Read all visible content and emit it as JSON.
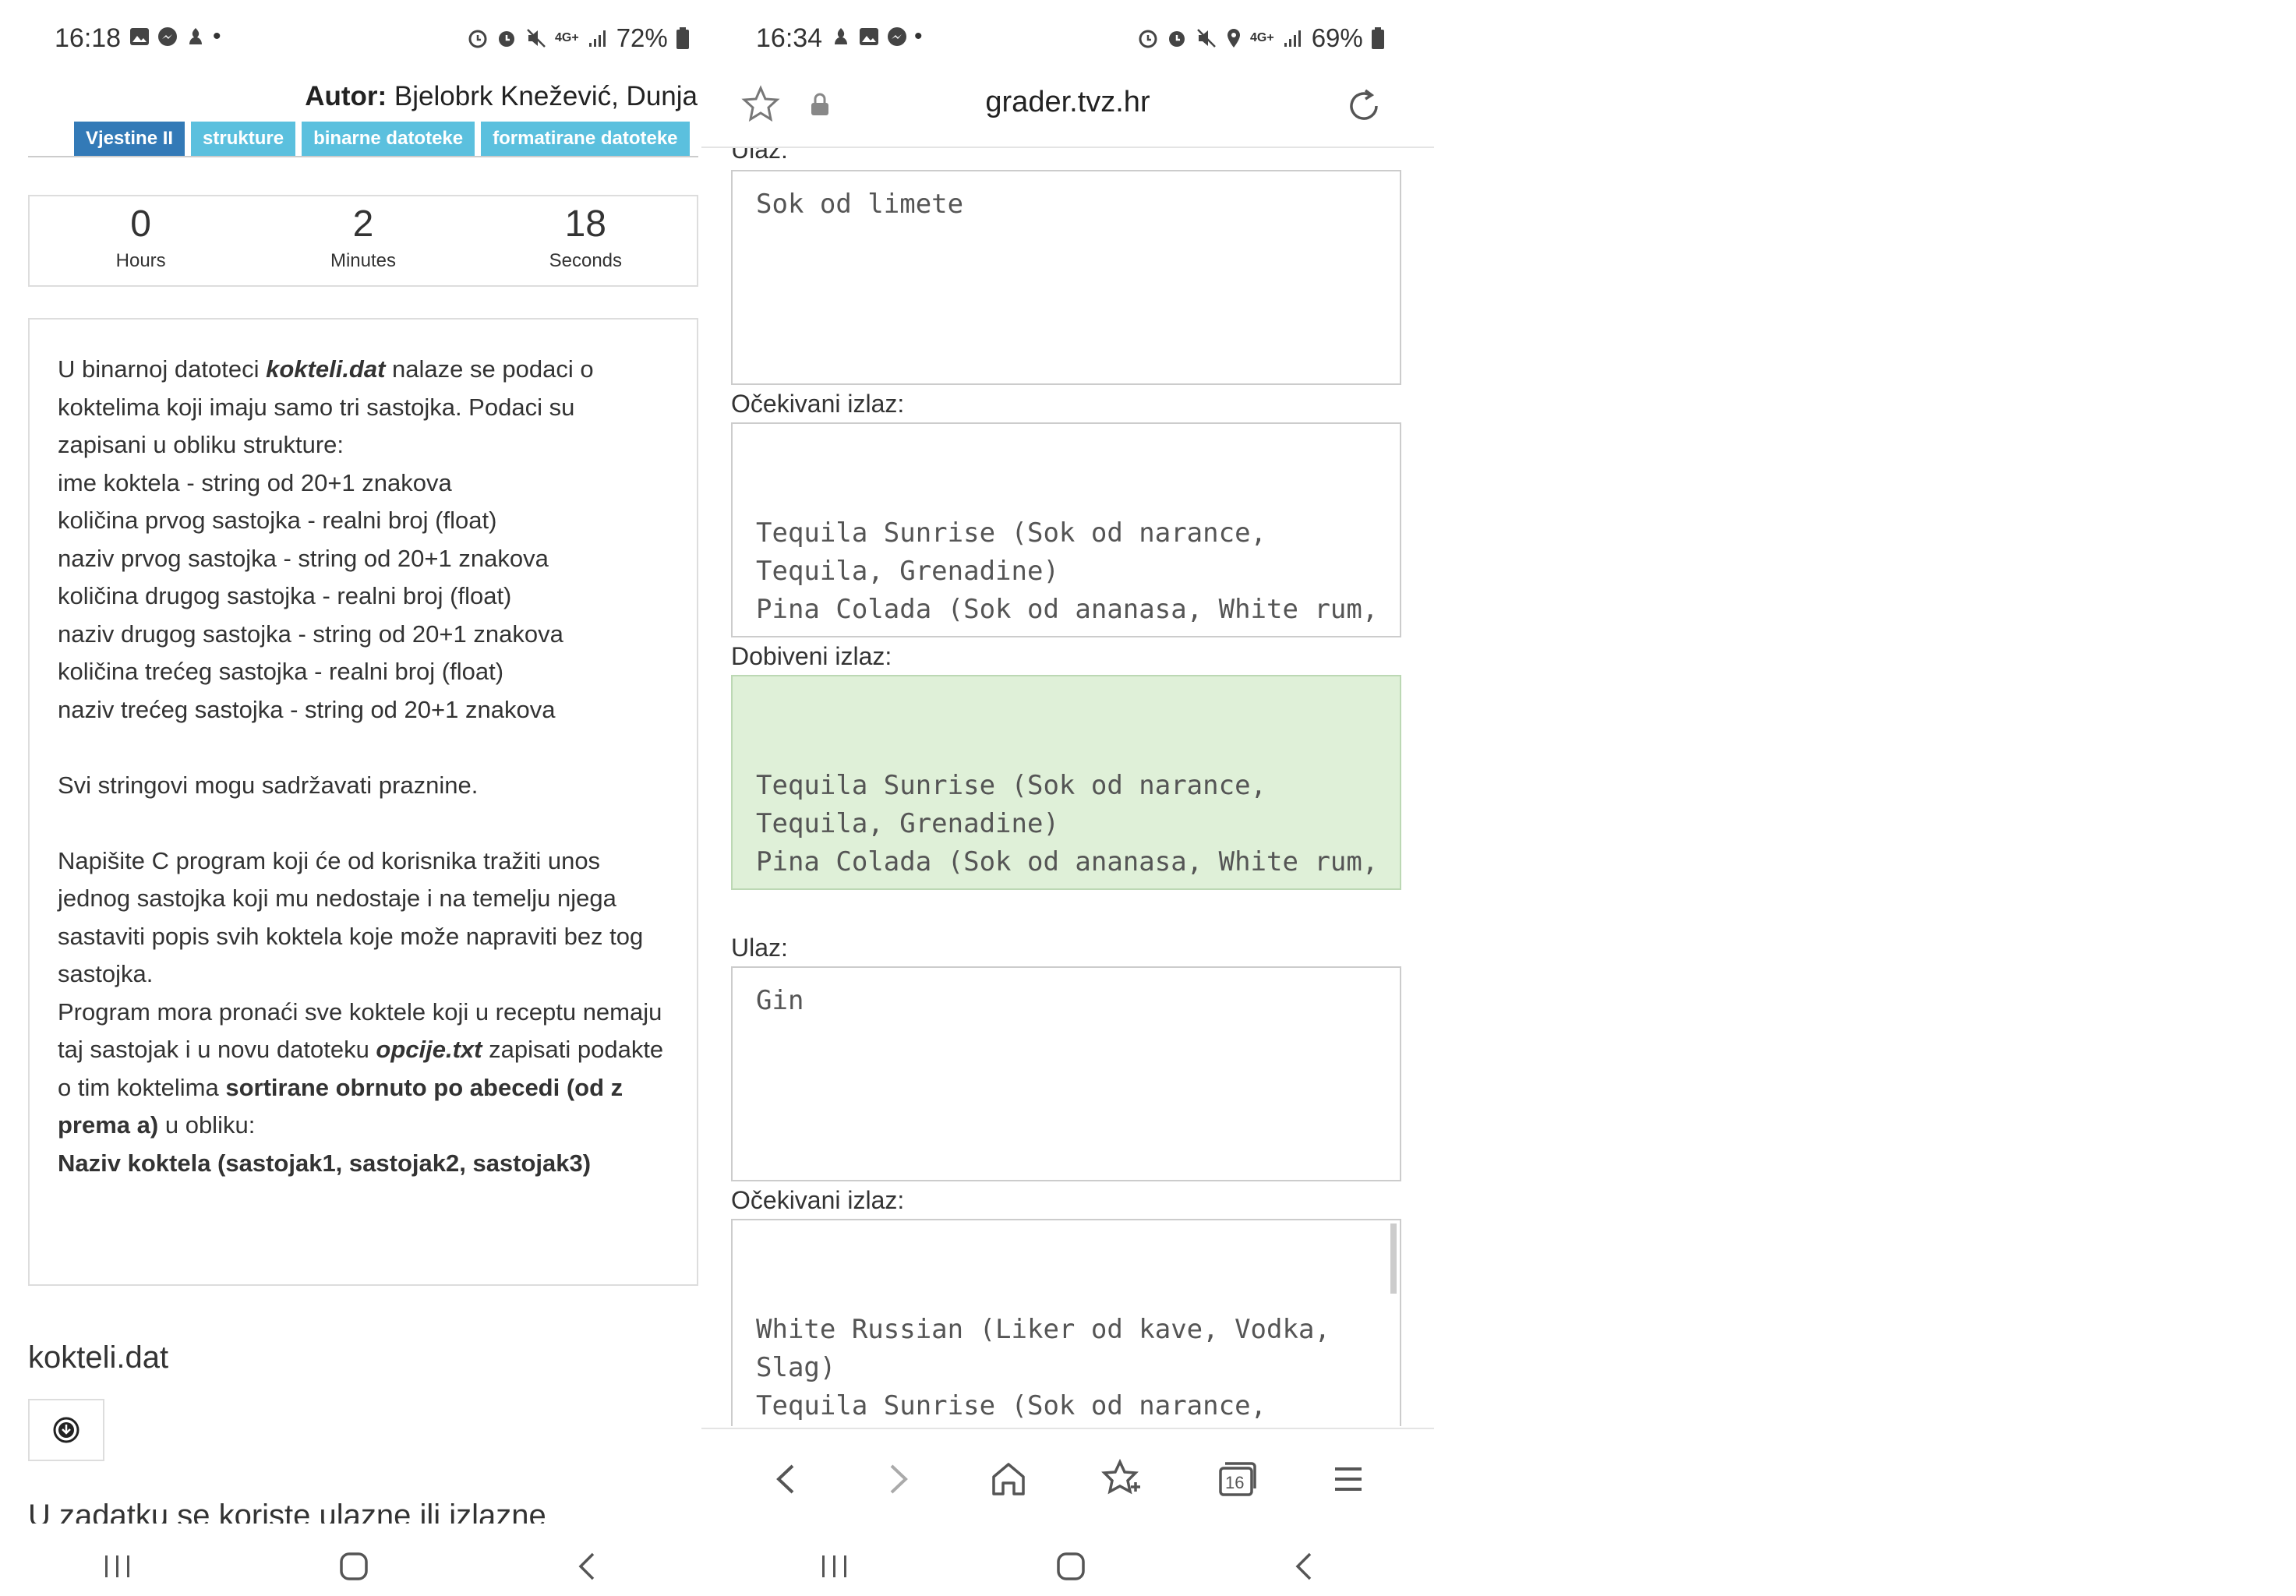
{
  "left": {
    "status": {
      "time": "16:18",
      "battery": "72%",
      "network": "4G+"
    },
    "author": {
      "label": "Autor:",
      "name": "Bjelobrk Knežević, Dunja"
    },
    "tags": [
      "Vjestine II",
      "strukture",
      "binarne datoteke",
      "formatirane datoteke"
    ],
    "timer": [
      {
        "value": "0",
        "label": "Hours"
      },
      {
        "value": "2",
        "label": "Minutes"
      },
      {
        "value": "18",
        "label": "Seconds"
      }
    ],
    "task": {
      "p1_pre": "U binarnoj datoteci ",
      "p1_file": "kokteli.dat",
      "p1_post": " nalaze se podaci o koktelima koji imaju samo tri sastojka. Podaci su zapisani u obliku strukture:",
      "fields": [
        "ime koktela - string od 20+1 znakova",
        "količina prvog sastojka - realni broj (float)",
        "naziv prvog sastojka - string od 20+1 znakova",
        "količina drugog sastojka - realni broj (float)",
        "naziv drugog sastojka - string od 20+1 znakova",
        "količina trećeg sastojka - realni broj (float)",
        "naziv trećeg sastojka - string od 20+1 znakova"
      ],
      "p2": "Svi stringovi mogu sadržavati praznine.",
      "p3": "Napišite C program koji će od korisnika tražiti unos jednog sastojka koji mu nedostaje i na temelju njega sastaviti popis svih koktela koje može napraviti bez tog sastojka.",
      "p4_pre": "Program mora pronaći sve koktele koji u receptu nemaju taj sastojak i u novu datoteku ",
      "p4_file": "opcije.txt",
      "p4_mid": " zapisati podakte o tim koktelima ",
      "p4_bold": "sortirane obrnuto po abecedi (od z prema a)",
      "p4_post": " u obliku:",
      "p5": "Naziv koktela (sastojak1, sastojak2, sastojak3)"
    },
    "file_title": "kokteli.dat",
    "cut_heading": "U zadatku se koriste ulazne ili izlazne"
  },
  "right": {
    "status": {
      "time": "16:34",
      "battery": "69%",
      "network": "4G+"
    },
    "url": "grader.tvz.hr",
    "blocks": [
      {
        "label": "Ulaz:",
        "text": "Sok od limete",
        "kind": "input"
      },
      {
        "label": "Očekivani izlaz:",
        "text": "Tequila Sunrise (Sok od narance,\nTequila, Grenadine)\nPina Colada (Sok od ananasa, White rum,\nLiker od kokosa)",
        "kind": "expected"
      },
      {
        "label": "Dobiveni izlaz:",
        "text": "Tequila Sunrise (Sok od narance,\nTequila, Grenadine)\nPina Colada (Sok od ananasa, White rum,\nLiker od kokosa)",
        "kind": "actual"
      },
      {
        "label": "Ulaz:",
        "text": "Gin",
        "kind": "input"
      },
      {
        "label": "Očekivani izlaz:",
        "text": "White Russian (Liker od kave, Vodka,\nSlag)\nTequila Sunrise (Sok od narance,\nTequila, Grenadine)\nPina Colada (Sok od ananasa, White rum,",
        "kind": "expected"
      }
    ],
    "tab_count": "16"
  },
  "colors": {
    "tag_primary": "#337ab7",
    "tag_info": "#5bc0de",
    "success_bg": "#dff0d8"
  }
}
